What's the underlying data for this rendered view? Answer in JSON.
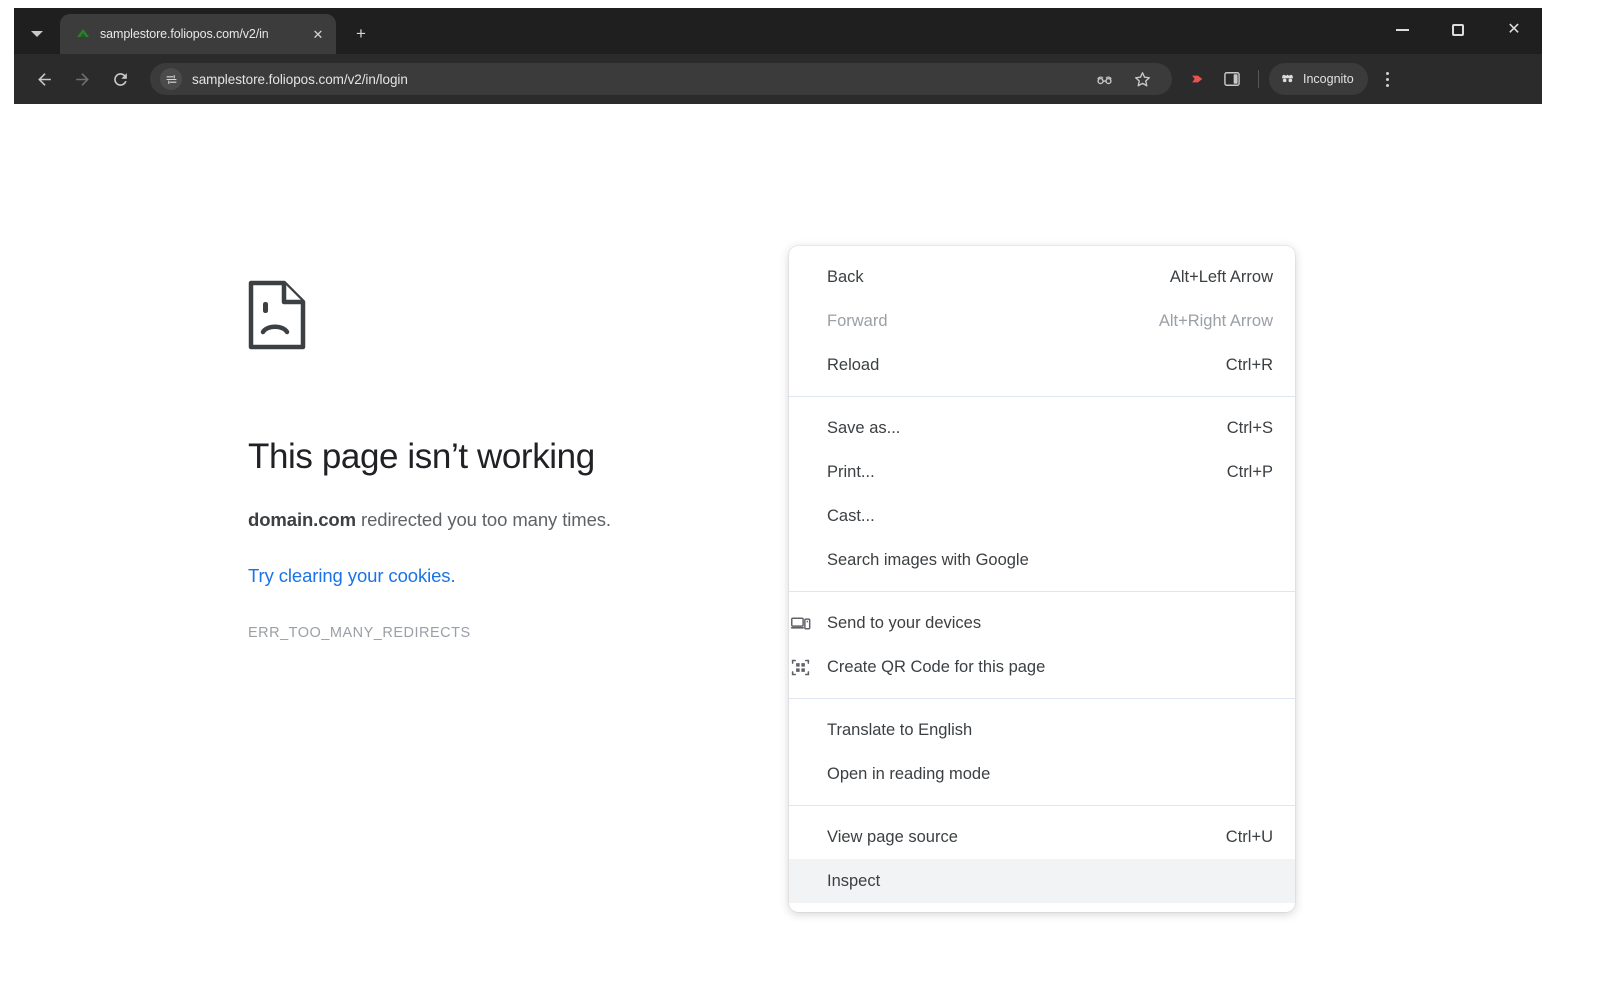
{
  "browser": {
    "tab": {
      "title": "samplestore.foliopos.com/v2/in",
      "favicon_name": "site-favicon",
      "close_glyph": "✕",
      "new_tab_glyph": "+"
    },
    "tab_search_label": "Search tabs",
    "window_controls": {
      "minimize": "—",
      "maximize": "□",
      "close": "✕"
    },
    "toolbar": {
      "back_label": "Back",
      "forward_label": "Forward",
      "reload_label": "Reload",
      "site_info_label": "View site information",
      "url": "samplestore.foliopos.com/v2/in/login",
      "glasses_icon": "incognito-glasses-icon",
      "bookmark_icon": "star-icon",
      "extension_icon": "extension-icon",
      "side_panel_icon": "side-panel-icon",
      "incognito_chip_label": "Incognito",
      "menu_label": "Customize and control Google Chrome"
    }
  },
  "error_page": {
    "icon_name": "sad-page-icon",
    "title": "This page isn’t working",
    "description_domain": "domain.com",
    "description_rest": " redirected you too many times.",
    "link_text": "Try clearing your cookies.",
    "error_code": "ERR_TOO_MANY_REDIRECTS"
  },
  "context_menu": {
    "groups": [
      {
        "items": [
          {
            "label": "Back",
            "shortcut": "Alt+Left Arrow",
            "disabled": false,
            "highlighted": false,
            "icon": null
          },
          {
            "label": "Forward",
            "shortcut": "Alt+Right Arrow",
            "disabled": true,
            "highlighted": false,
            "icon": null
          },
          {
            "label": "Reload",
            "shortcut": "Ctrl+R",
            "disabled": false,
            "highlighted": false,
            "icon": null
          }
        ]
      },
      {
        "items": [
          {
            "label": "Save as...",
            "shortcut": "Ctrl+S",
            "disabled": false,
            "highlighted": false,
            "icon": null
          },
          {
            "label": "Print...",
            "shortcut": "Ctrl+P",
            "disabled": false,
            "highlighted": false,
            "icon": null
          },
          {
            "label": "Cast...",
            "shortcut": "",
            "disabled": false,
            "highlighted": false,
            "icon": null
          },
          {
            "label": "Search images with Google",
            "shortcut": "",
            "disabled": false,
            "highlighted": false,
            "icon": null
          }
        ]
      },
      {
        "items": [
          {
            "label": "Send to your devices",
            "shortcut": "",
            "disabled": false,
            "highlighted": false,
            "icon": "devices-icon"
          },
          {
            "label": "Create QR Code for this page",
            "shortcut": "",
            "disabled": false,
            "highlighted": false,
            "icon": "qr-code-icon"
          }
        ]
      },
      {
        "items": [
          {
            "label": "Translate to English",
            "shortcut": "",
            "disabled": false,
            "highlighted": false,
            "icon": null
          },
          {
            "label": "Open in reading mode",
            "shortcut": "",
            "disabled": false,
            "highlighted": false,
            "icon": null
          }
        ]
      },
      {
        "items": [
          {
            "label": "View page source",
            "shortcut": "Ctrl+U",
            "disabled": false,
            "highlighted": false,
            "icon": null
          },
          {
            "label": "Inspect",
            "shortcut": "",
            "disabled": false,
            "highlighted": true,
            "icon": null
          }
        ]
      }
    ]
  },
  "colors": {
    "tabstrip_bg": "#1f1f1f",
    "toolbar_bg": "#2b2b2b",
    "active_tab_bg": "#3c3c3c",
    "omnibox_bg": "#3b3b3b",
    "page_bg": "#ffffff",
    "link": "#1a73e8",
    "menu_highlight": "#f1f3f4",
    "menu_separator": "#dfe6f2",
    "extension_red": "#e8544d",
    "favicon_green": "#2e7d32"
  }
}
